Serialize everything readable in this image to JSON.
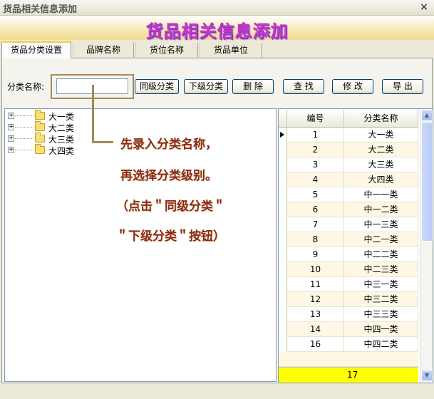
{
  "window": {
    "title": "货品相关信息添加",
    "close_glyph": "×"
  },
  "banner": {
    "title": "货品相关信息添加"
  },
  "tabs": [
    {
      "label": "货品分类设置",
      "active": true
    },
    {
      "label": "品牌名称",
      "active": false
    },
    {
      "label": "货位名称",
      "active": false
    },
    {
      "label": "货品单位",
      "active": false
    }
  ],
  "toolbar": {
    "category_label": "分类名称:",
    "category_value": "",
    "buttons": {
      "same_level": "同级分类",
      "sub_level": "下级分类",
      "delete": "删 除",
      "find": "查 找",
      "modify": "修 改",
      "export": "导 出"
    }
  },
  "tree": {
    "expander_glyph": "+",
    "items": [
      "大一类",
      "大二类",
      "大三类",
      "大四类"
    ]
  },
  "annotation": {
    "lines": [
      "先录入分类名称，",
      "再选择分类级别。",
      "（点击＂同级分类＂",
      "＂下级分类＂按钮）"
    ]
  },
  "grid": {
    "headers": [
      "编号",
      "分类名称"
    ],
    "rows": [
      [
        "1",
        "大一类"
      ],
      [
        "2",
        "大二类"
      ],
      [
        "3",
        "大三类"
      ],
      [
        "4",
        "大四类"
      ],
      [
        "5",
        "中一一类"
      ],
      [
        "6",
        "中一二类"
      ],
      [
        "7",
        "中一三类"
      ],
      [
        "8",
        "中二一类"
      ],
      [
        "9",
        "中二二类"
      ],
      [
        "10",
        "中二三类"
      ],
      [
        "11",
        "中三一类"
      ],
      [
        "12",
        "中三二类"
      ],
      [
        "13",
        "中三三类"
      ],
      [
        "14",
        "中四一类"
      ],
      [
        "16",
        "中四二类"
      ]
    ],
    "footer_count": "17"
  },
  "colors": {
    "banner_text": "#cc33cc",
    "annotation_text": "#8b2a14",
    "annotation_frame": "#a48a58",
    "footer_highlight": "#ffff00"
  },
  "icons": [
    "close-icon",
    "expand-icon",
    "folder-icon",
    "row-pointer-icon",
    "scroll-up-icon",
    "scroll-down-icon"
  ]
}
